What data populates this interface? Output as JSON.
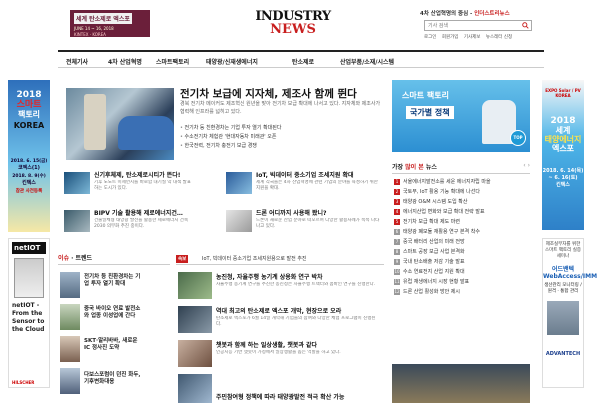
{
  "header": {
    "banner": {
      "line1": "세계 탄소제로 엑스포",
      "line2": "JUNE 14 ~ 16, 2018",
      "line3": "KINTEX · KOREA"
    },
    "logo_top": "INDUSTRY",
    "logo_bottom": "NEWS",
    "tagline_prefix": "4차 산업혁명의 중심 - ",
    "tagline_brand": "인더스트리뉴스",
    "search_placeholder": "기사 검색",
    "top_links": [
      "로그인",
      "회원가입",
      "기사제보",
      "뉴스레터 신청"
    ]
  },
  "nav": [
    "전체기사",
    "4차 산업혁명",
    "스마트팩토리",
    "태양광/신재생에너지",
    "탄소제로",
    "산업부품/소재/시스템"
  ],
  "left_ad_top": {
    "year": "2018",
    "b1": "스마트",
    "b2": "팩토리",
    "korea": "KOREA",
    "date": "2018. 6. 15(금)",
    "venue": "코엑스(1)",
    "date2": "2018. 8. 9(수)",
    "venue2": "킨텍스",
    "cta": "참관 사전등록"
  },
  "left_ad_bottom": {
    "brand": "netIOT",
    "text": "netIOT - From the Sensor to the Cloud",
    "footer": "HILSCHER"
  },
  "right_ad_top": {
    "logo": "EXPO Solar / PV KOREA",
    "year": "2018",
    "b1": "세계",
    "b2": "태양에너지",
    "b3": "엑스포",
    "date": "2018. 6. 14(목) ~ 6. 16(토)",
    "venue": "킨텍스"
  },
  "right_ad_bottom": {
    "t": "제조실무자를 위한 스마트 팩토리 실증 세미나",
    "h": "어드밴텍 WebAccess/IMM",
    "s": "생산관리 모니터링 / 원격 · 통합 관리",
    "brand": "ADVANTECH"
  },
  "headline": {
    "title": "전기차 보급에 지자체, 제조사 함께 뛴다",
    "summary": "경북 전기차 메이커도 제조혁신 원년을 맞아 전기차 보급 확대에 나서고 있다. 지자체와 제조사가 협력해 인프라를 넓히고 있다.",
    "bullets": [
      "전기차 등 친환경차는 기업 투자 열기 확대된다",
      "수소전기차 체험관 '현대자동차 미래관' 오픈",
      "한국전력, 전기차 충전기 보급 경쟁"
    ]
  },
  "grid_news": [
    {
      "title": "신기후체제, 탄소제로시티가 뜬다!",
      "desc": "기후 노노트 미세먼지를 바로함 대기질 악 대책 발표하는 도시가 있다."
    },
    {
      "title": "IoT, 빅데이터 중소기업 조세지원 확대",
      "desc": "세계 각국들은 4차 산업혁명에 관련 기업의 분야를 육성하기 위한 지원을 확대."
    },
    {
      "title": "BIPV 기술 활용해 제로에너지건…",
      "desc": "건물일체형 태양광 발전을 활용한 제로에너지 건축 2030 의무화 추진 중이다."
    },
    {
      "title": "드론 어디까지 사용해 봤니?",
      "desc": "드론이 새로운 산업 분야로 떠오르며 다양한 활용사례가 속속 나타나고 있다."
    }
  ],
  "issue": {
    "head_red": "이슈",
    "head_rest": " · 트렌드",
    "items": [
      {
        "title": "전기차 등 친환경차는 기업 투자 열기 확대"
      },
      {
        "title": "중국 바이오 연료 발전소와 업종 이성업에 간다"
      },
      {
        "title": "SKT·알리바바, 새로운 IC 정사진 도약"
      },
      {
        "title": "다보스포럼이 던진 화두, 기후변화대응"
      }
    ]
  },
  "center": {
    "badge": "속보",
    "ticker": "IoT, 빅데이터 중소기업 조세지원용으로 발전 추진",
    "items": [
      {
        "title": "농진청, 자율주행 농기계 상용화 연구 박차",
        "desc": "자율주행 농기계 연구를 추진한 농진청은 자율주행 트랙터와 콤바인 연구를 진행한다."
      },
      {
        "title": "역대 최고의 탄소제로 엑스포 개막, 현장으로 오라",
        "desc": "탄소제로 엑스포가 6월 14일 개막해 기업들의 참여와 다양한 체험 프로그램이 진행된다."
      },
      {
        "title": "챗봇과 함께 하는 일상생활, 챗봇과 같다",
        "desc": "인공지능 기반 챗봇이 가정에서 일상생활을 돕는 역할을 하고 있다."
      },
      {
        "title": "주민참여형 정책에 따라 태양광발전 적극 확산 가능",
        "desc": ""
      }
    ]
  },
  "feature": {
    "t1": "스마트 팩토리",
    "t2": "국가별 정책",
    "tag": "TOP"
  },
  "popular": {
    "head_pre": "가장 ",
    "head_red": "많이 본",
    "head_post": " 뉴스",
    "items": [
      "서울에너지발전소를 세운 에너지자립 마을",
      "국토부, IoT 활용 기능 확대에 나선다",
      "태양광 O&M 시스템 도입 확산",
      "에너지산업 변화와 보급 확대 전략 발표",
      "전기차 보급 확대 제도 마련",
      "태양광 폐모듈 재활용 연구 본격 착수",
      "중국 배터리 산업의 미래 전망",
      "스마트 공장 보급 사업 본격화",
      "국내 탄소배출 저감 기술 발표",
      "수소 연료전지 산업 지원 확대",
      "유럽 재생에너지 시장 현황 발표",
      "드론 산업 활성화 방안 제시"
    ]
  }
}
